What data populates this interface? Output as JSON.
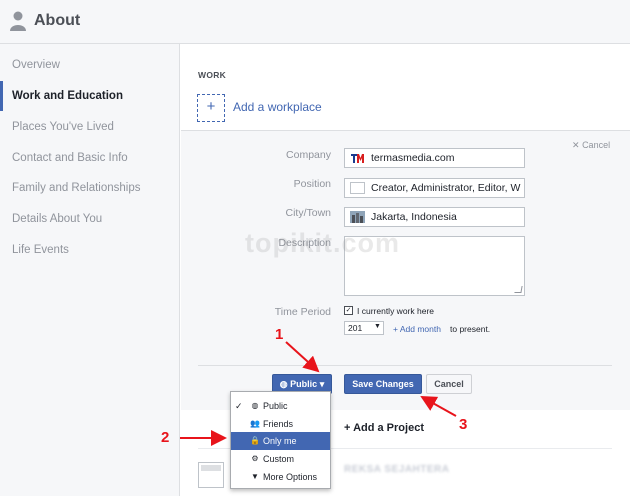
{
  "header": {
    "title": "About"
  },
  "sidebar": {
    "items": [
      {
        "label": "Overview"
      },
      {
        "label": "Work and Education"
      },
      {
        "label": "Places You've Lived"
      },
      {
        "label": "Contact and Basic Info"
      },
      {
        "label": "Family and Relationships"
      },
      {
        "label": "Details About You"
      },
      {
        "label": "Life Events"
      }
    ]
  },
  "work": {
    "heading": "WORK",
    "add_workplace": "Add a workplace",
    "add_icon": "+"
  },
  "form": {
    "cancel": "Cancel",
    "company_label": "Company",
    "company_value": "termasmedia.com",
    "position_label": "Position",
    "position_value": "Creator, Administrator, Editor, W",
    "city_label": "City/Town",
    "city_value": "Jakarta, Indonesia",
    "description_label": "Description",
    "time_period_label": "Time Period",
    "currently_work_label": "I currently work here",
    "year_value": "201",
    "add_month": "Add month",
    "to_present": "to present."
  },
  "buttons": {
    "privacy": "Public",
    "save": "Save Changes",
    "cancel": "Cancel"
  },
  "privacy_menu": {
    "items": [
      {
        "label": "Public",
        "icon": "globe-icon",
        "checked": true
      },
      {
        "label": "Friends",
        "icon": "friends-icon"
      },
      {
        "label": "Only me",
        "icon": "lock-icon",
        "highlighted": true
      },
      {
        "label": "Custom",
        "icon": "gear-icon"
      },
      {
        "label": "More Options",
        "icon": "caret-down-icon"
      }
    ]
  },
  "projects": {
    "add_project": "+ Add a Project"
  },
  "entry": {
    "name": "REKSA SEJAHTERA"
  },
  "watermark": "topikit.com",
  "annotations": {
    "one": "1",
    "two": "2",
    "three": "3"
  },
  "colors": {
    "accent": "#4267b2",
    "annotation_red": "#e8141b",
    "panel_bg": "#f6f7f9"
  }
}
